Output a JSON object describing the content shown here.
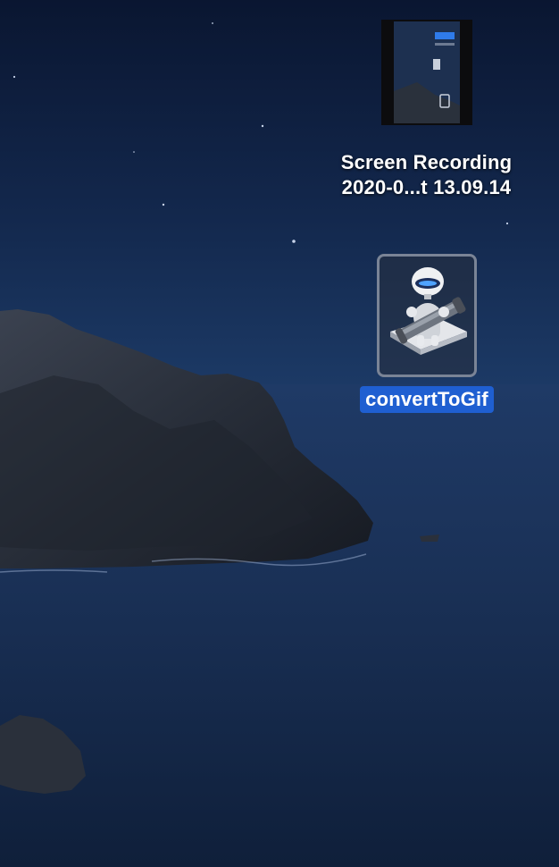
{
  "desktop": {
    "wallpaper": "macos-catalina-island-night",
    "icons": [
      {
        "id": "screen-recording",
        "label_line1": "Screen Recording",
        "label_line2": "2020-0...t 13.09.14",
        "icon": "video-thumbnail-icon",
        "selected": false
      },
      {
        "id": "convert-to-gif",
        "label": "convertToGif",
        "icon": "automator-robot-icon",
        "selected": true
      }
    ]
  },
  "colors": {
    "selection": "#1f5fd1",
    "label_text": "#ffffff",
    "sky_top": "#0a1730",
    "ocean": "#1c3258"
  }
}
